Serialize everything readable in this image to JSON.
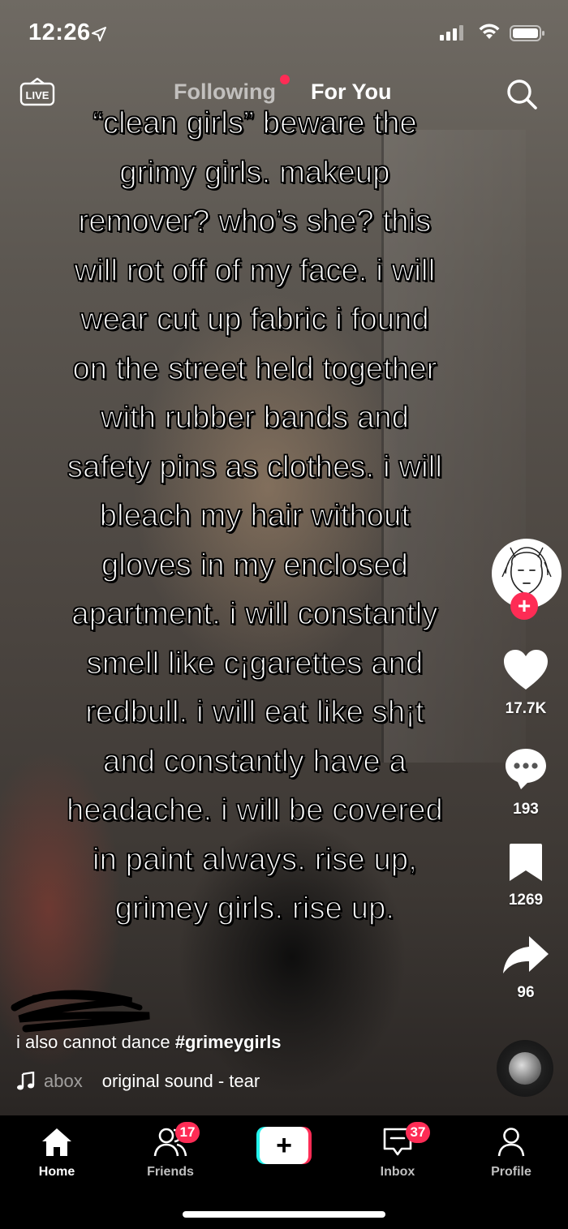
{
  "status_bar": {
    "time": "12:26"
  },
  "top_nav": {
    "live_label": "LIVE",
    "tabs": [
      {
        "label": "Following",
        "active": false,
        "has_dot": true
      },
      {
        "label": "For You",
        "active": true
      }
    ]
  },
  "caption_lines": [
    "“clean girls” beware the",
    "grimy girls. makeup",
    "remover? who’s she? this",
    "will rot off of my face. i will",
    "wear cut up fabric i found",
    "on the street held together",
    "with rubber bands and",
    "safety pins as clothes. i will",
    "bleach my hair without",
    "gloves in my enclosed",
    "apartment. i will constantly",
    "smell like c¡garettes and",
    "redbull. i will eat like sh¡t",
    "and constantly have a",
    "headache. i will be covered",
    "in paint always. rise up,",
    "grimey girls. rise up."
  ],
  "rail": {
    "likes": "17.7K",
    "comments": "193",
    "saves": "1269",
    "shares": "96",
    "follow_symbol": "+"
  },
  "description": {
    "text": "i also cannot dance ",
    "hashtag": "#grimeygirls"
  },
  "sound": {
    "user_fragment": "abox",
    "title": "original sound - tear"
  },
  "tab_bar": {
    "items": [
      {
        "label": "Home",
        "active": true
      },
      {
        "label": "Friends",
        "badge": "17"
      },
      {
        "label": "+"
      },
      {
        "label": "Inbox",
        "badge": "37"
      },
      {
        "label": "Profile"
      }
    ]
  },
  "colors": {
    "accent": "#fe2c55",
    "cyan": "#25f4ee"
  }
}
